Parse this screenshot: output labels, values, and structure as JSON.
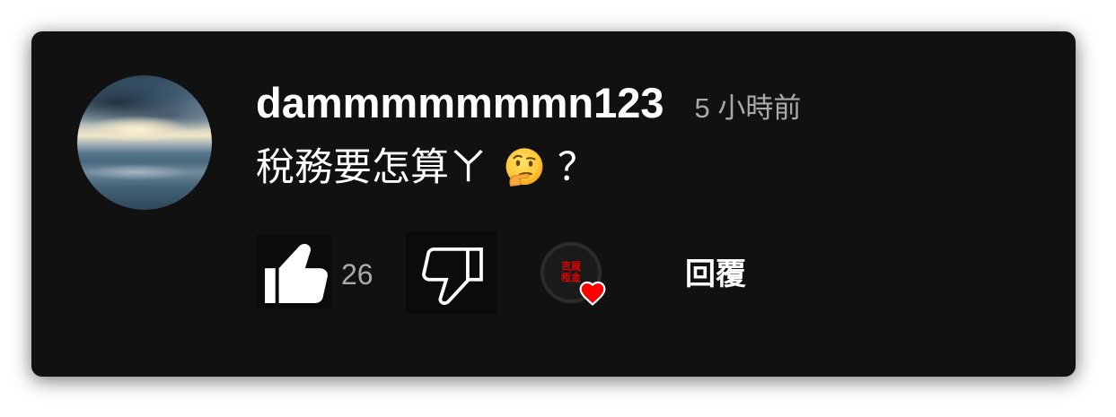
{
  "comment": {
    "author": {
      "username": "dammmmmmmn123",
      "avatar_icon": "seascape-avatar"
    },
    "timestamp": "5 小時前",
    "text": {
      "before_emoji": "稅務要怎算ㄚ",
      "emoji_icon": "thinking-face-emoji",
      "after_emoji": "？"
    }
  },
  "actions": {
    "like": {
      "icon": "thumbs-up-filled-icon",
      "count": "26"
    },
    "dislike": {
      "icon": "thumbs-down-outline-icon"
    },
    "creator_heart": {
      "avatar_text_line1": "吉屋",
      "avatar_text_line2": "租金",
      "badge_icon": "heart-icon"
    },
    "reply_label": "回覆"
  },
  "colors": {
    "card_background": "#111111",
    "primary_text": "#ffffff",
    "secondary_text": "#aaaaaa",
    "heart": "#ff0000",
    "creator_logo_text": "#e00000"
  }
}
